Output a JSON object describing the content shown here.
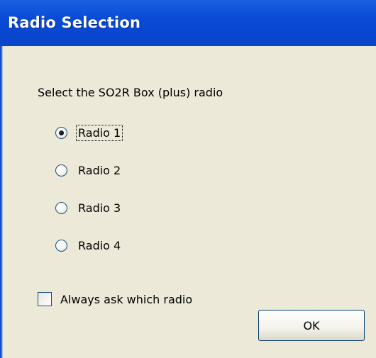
{
  "window": {
    "title": "Radio Selection"
  },
  "dialog": {
    "prompt": "Select the SO2R Box (plus) radio",
    "radios": [
      {
        "label": "Radio 1",
        "selected": true,
        "focused": true
      },
      {
        "label": "Radio 2",
        "selected": false,
        "focused": false
      },
      {
        "label": "Radio 3",
        "selected": false,
        "focused": false
      },
      {
        "label": "Radio 4",
        "selected": false,
        "focused": false
      }
    ],
    "checkbox": {
      "label": "Always ask which radio",
      "checked": false
    },
    "ok_label": "OK"
  },
  "colors": {
    "titlebar": "#0a4bd6",
    "client_background": "#ece9d8",
    "title_text": "#ffffff"
  }
}
